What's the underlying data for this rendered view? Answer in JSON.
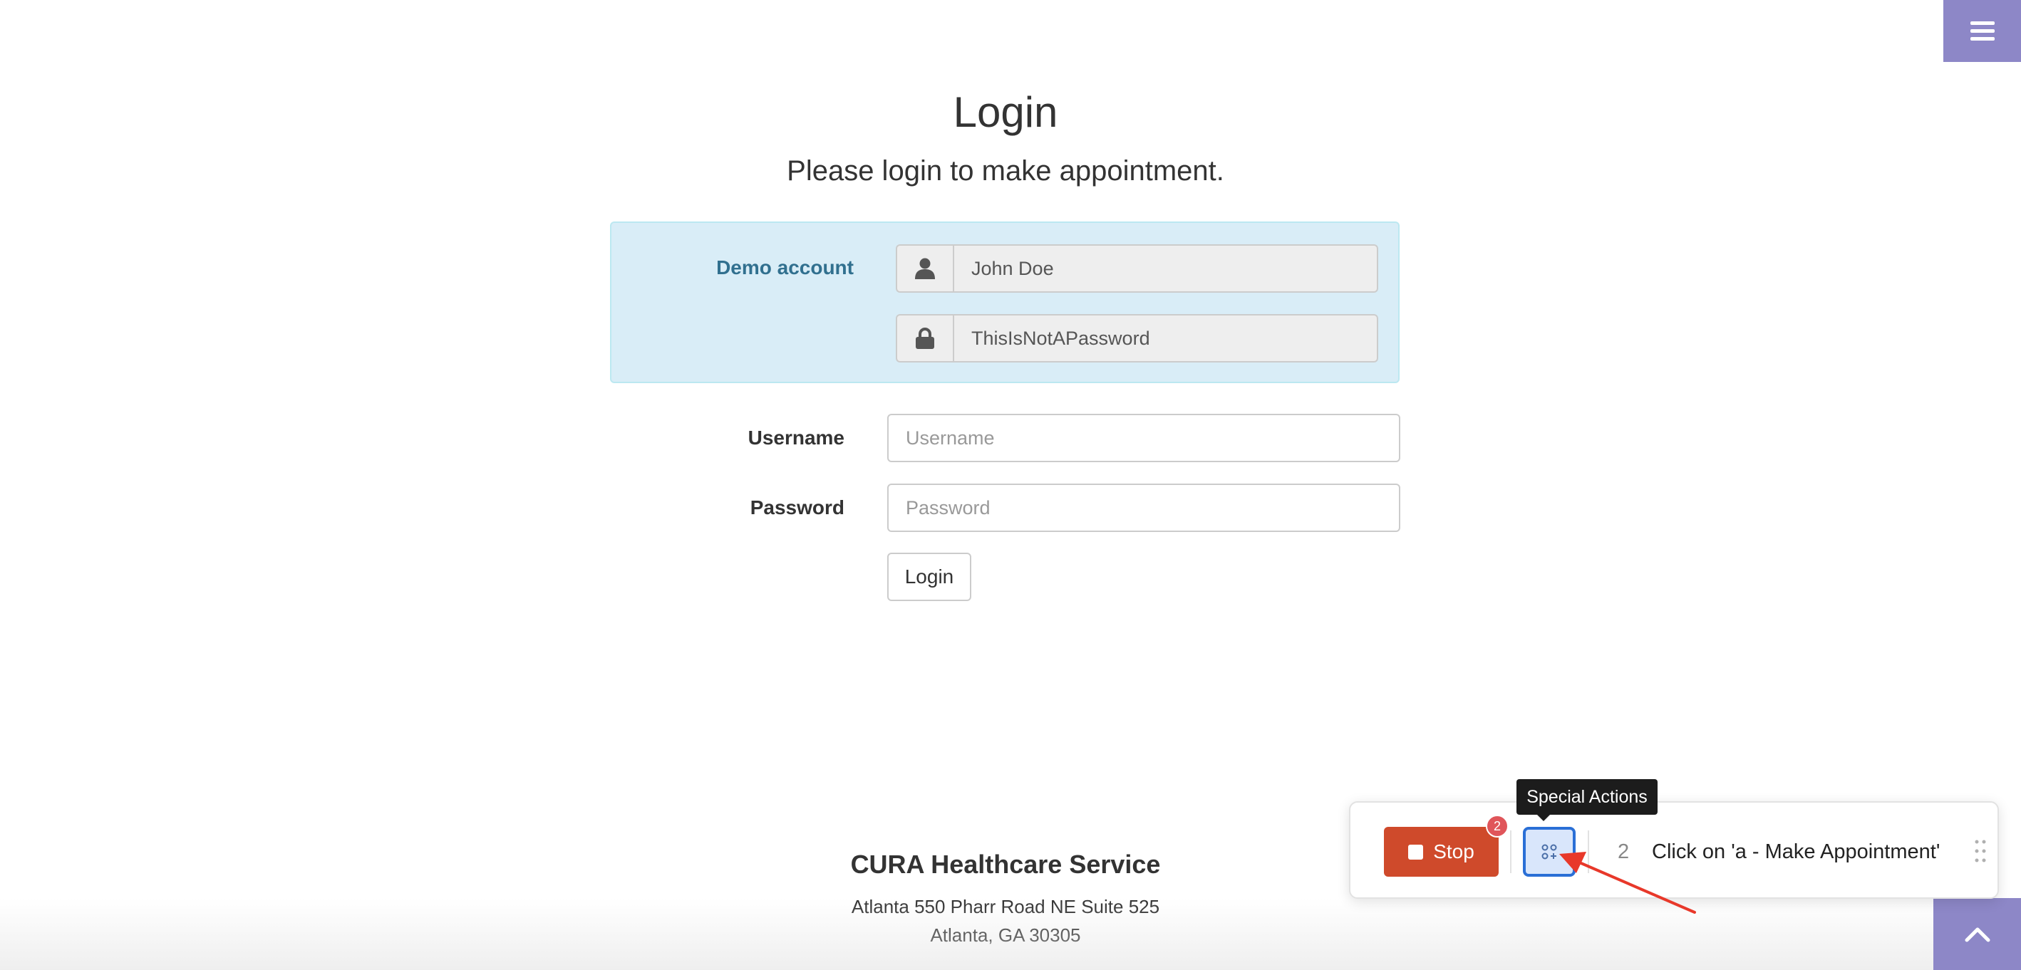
{
  "header": {
    "menu_icon": "hamburger-icon"
  },
  "login": {
    "title": "Login",
    "subtitle": "Please login to make appointment.",
    "demo": {
      "label": "Demo account",
      "username_icon": "user-icon",
      "username_value": "John Doe",
      "password_icon": "lock-icon",
      "password_value": "ThisIsNotAPassword"
    },
    "username_label": "Username",
    "username_placeholder": "Username",
    "password_label": "Password",
    "password_placeholder": "Password",
    "submit_label": "Login"
  },
  "footer": {
    "title": "CURA Healthcare Service",
    "address_line1": "Atlanta 550 Pharr Road NE Suite 525",
    "address_line2": "Atlanta, GA 30305",
    "scroll_top_icon": "chevron-up-icon"
  },
  "recorder": {
    "stop_label": "Stop",
    "badge_count": "2",
    "special_actions_icon": "grid-icon",
    "tooltip": "Special Actions",
    "step_number": "2",
    "step_text": "Click on 'a - Make Appointment'",
    "drag_icon": "drag-handle-icon"
  },
  "colors": {
    "accent": "#8d87c7",
    "demo_bg": "#d9edf7",
    "demo_text": "#31708f",
    "stop": "#cf4a2b",
    "badge": "#e0555a",
    "special_border": "#2a6fd6",
    "annotation_arrow": "#e8382a"
  }
}
